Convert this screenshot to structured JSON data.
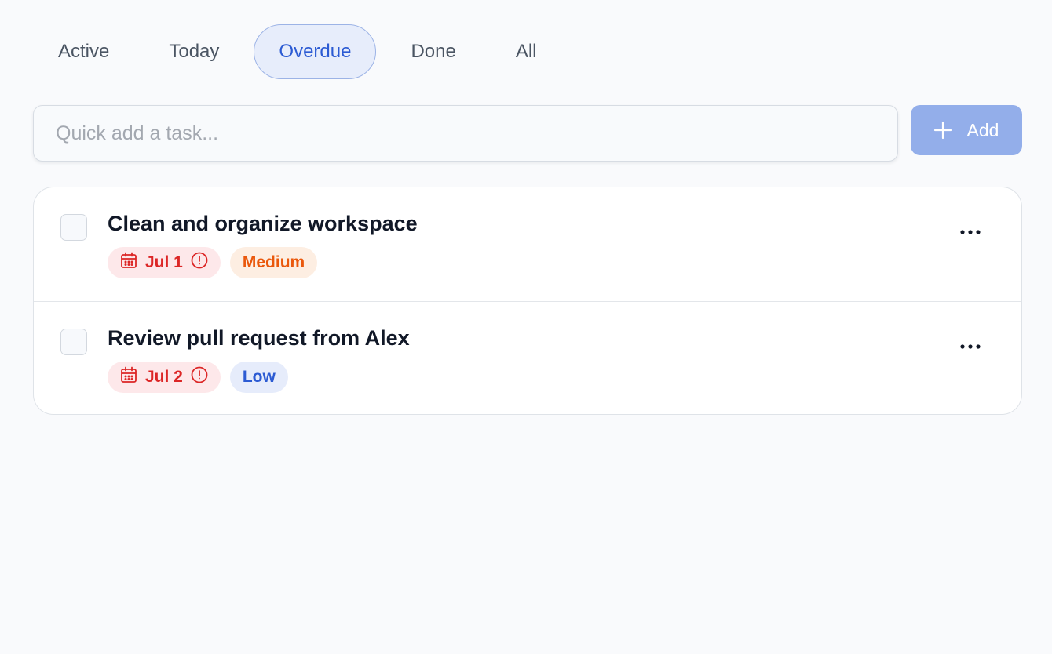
{
  "tabs": [
    {
      "label": "Active"
    },
    {
      "label": "Today"
    },
    {
      "label": "Overdue",
      "active": true
    },
    {
      "label": "Done"
    },
    {
      "label": "All"
    }
  ],
  "quick_add": {
    "placeholder": "Quick add a task...",
    "value": "",
    "button_label": "Add",
    "button_icon": "plus-icon"
  },
  "tasks": [
    {
      "title": "Clean and organize workspace",
      "due": "Jul 1",
      "overdue": true,
      "priority": "Medium",
      "completed": false
    },
    {
      "title": "Review pull request from Alex",
      "due": "Jul 2",
      "overdue": true,
      "priority": "Low",
      "completed": false
    }
  ],
  "colors": {
    "accent": "#2c5bd3",
    "accent_bg": "#e7edfb",
    "add_button": "#93aeea",
    "overdue": "#dc2626",
    "overdue_bg": "#fde8ea",
    "medium": "#ea580c",
    "medium_bg": "#fdeee2",
    "low": "#2c5bd3",
    "low_bg": "#e6ecfb"
  }
}
